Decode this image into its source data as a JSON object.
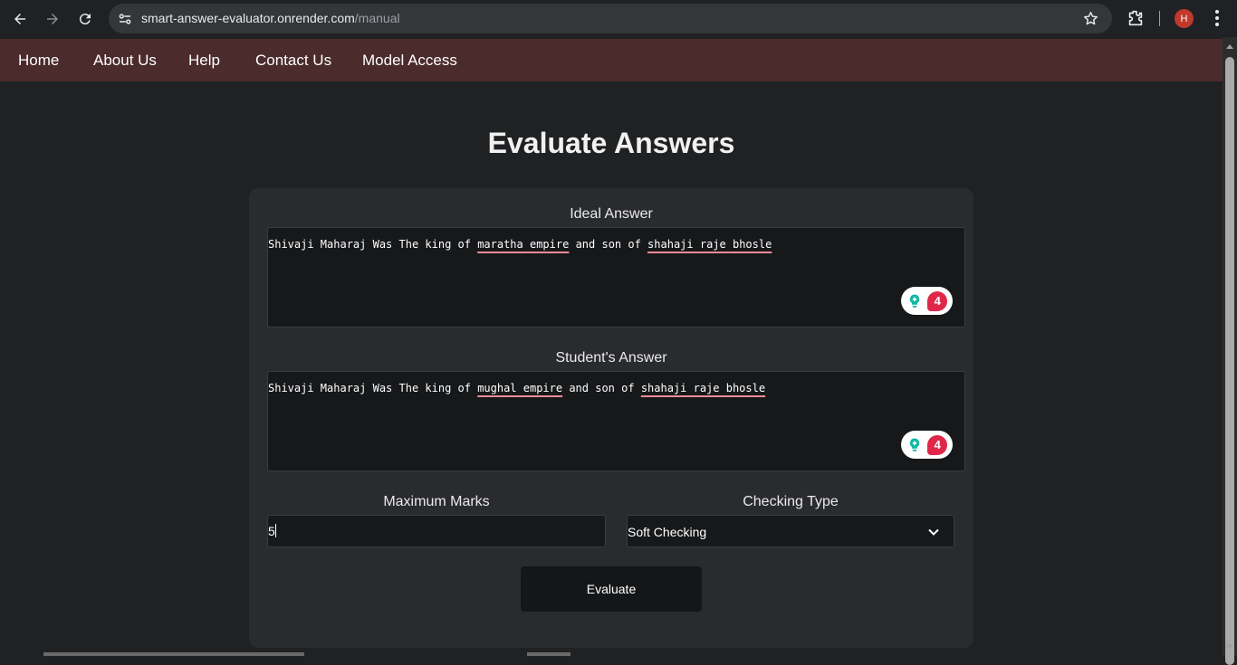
{
  "browser": {
    "url_host": "smart-answer-evaluator.onrender.com",
    "url_path": "/manual",
    "profile_initial": "H",
    "icons": [
      "back-icon",
      "forward-icon",
      "reload-icon",
      "site-settings-icon",
      "star-icon",
      "extensions-icon",
      "menu-icon"
    ]
  },
  "nav": {
    "items": [
      "Home",
      "About Us",
      "Help",
      "Contact Us",
      "Model Access"
    ]
  },
  "page": {
    "title": "Evaluate Answers"
  },
  "form": {
    "ideal_label": "Ideal Answer",
    "ideal_text_prefix": "Shivaji Maharaj Was The king of ",
    "ideal_text_err1": "maratha empire",
    "ideal_text_mid": " and son of ",
    "ideal_text_err2": "shahaji raje bhosle",
    "ideal_issue_count": "4",
    "student_label": "Student's Answer",
    "student_text_prefix": "Shivaji Maharaj Was The king of ",
    "student_text_err1": "mughal empire",
    "student_text_mid": " and son of ",
    "student_text_err2": "shahaji raje bhosle",
    "student_issue_count": "4",
    "max_marks_label": "Maximum Marks",
    "max_marks_value": "5",
    "checking_type_label": "Checking Type",
    "checking_type_value": "Soft Checking",
    "evaluate_label": "Evaluate"
  },
  "colors": {
    "nav_bg": "#4b2b2b",
    "page_bg": "#1f2123",
    "card_bg": "#2a2b2e",
    "spell_underline": "#f28b9b",
    "badge_count": "#e0274a",
    "badge_bulb": "#14b8a6"
  }
}
